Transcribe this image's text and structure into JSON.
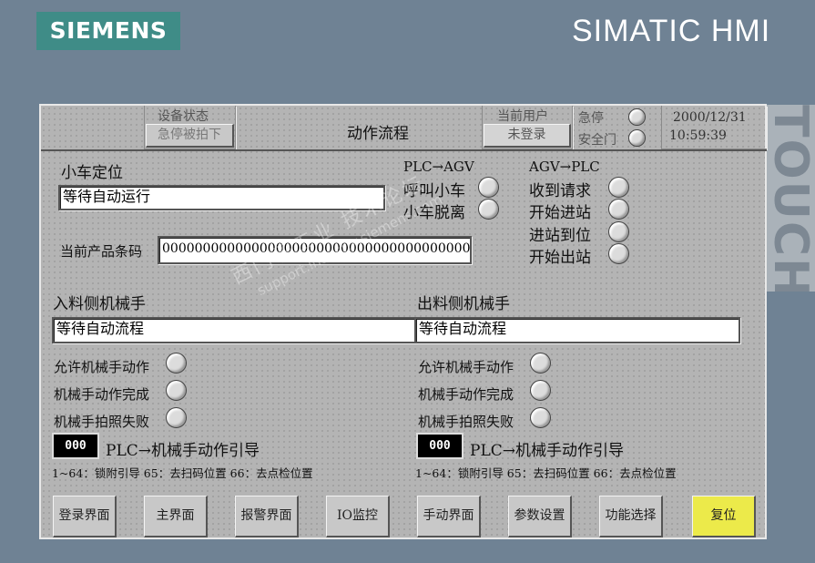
{
  "branding": {
    "logo": "SIEMENS",
    "title": "SIMATIC HMI",
    "side_label": "TOUCH"
  },
  "header": {
    "device_status_label": "设备状态",
    "device_status_value": "急停被拍下",
    "screen_title": "动作流程",
    "current_user_label": "当前用户",
    "user_button": "未登录",
    "estop_label": "急停",
    "safety_door_label": "安全门",
    "date": "2000/12/31",
    "time": "10:59:39"
  },
  "cart": {
    "title": "小车定位",
    "status": "等待自动运行",
    "barcode_label": "当前产品条码",
    "barcode": "00000000000000000000000000000000000000"
  },
  "plc_to_agv": {
    "title": "PLC→AGV",
    "signals": [
      "呼叫小车",
      "小车脱离"
    ]
  },
  "agv_to_plc": {
    "title": "AGV→PLC",
    "signals": [
      "收到请求",
      "开始进站",
      "进站到位",
      "开始出站"
    ]
  },
  "infeed_robot": {
    "title": "入料侧机械手",
    "status": "等待自动流程",
    "signals": [
      "允许机械手动作",
      "机械手动作完成",
      "机械手拍照失败"
    ],
    "guide_value": "000",
    "guide_label": "PLC→机械手动作引导",
    "guide_hint": "1~64：锁附引导 65：去扫码位置  66：去点检位置"
  },
  "outfeed_robot": {
    "title": "出料侧机械手",
    "status": "等待自动流程",
    "signals": [
      "允许机械手动作",
      "机械手动作完成",
      "机械手拍照失败"
    ],
    "guide_value": "000",
    "guide_label": "PLC→机械手动作引导",
    "guide_hint": "1~64：锁附引导 65：去扫码位置  66：去点检位置"
  },
  "nav_buttons": [
    "登录界面",
    "主界面",
    "报警界面",
    "IO监控",
    "手动界面",
    "参数设置",
    "功能选择",
    "复位"
  ],
  "watermark": {
    "line1": "西门子工业  技术论坛",
    "line2": "support.industry.siemens.com"
  },
  "colors": {
    "background": "#6f8294",
    "panel": "#b4b4b4",
    "logo": "#3f8c87",
    "reset_button": "#ecea4a"
  }
}
